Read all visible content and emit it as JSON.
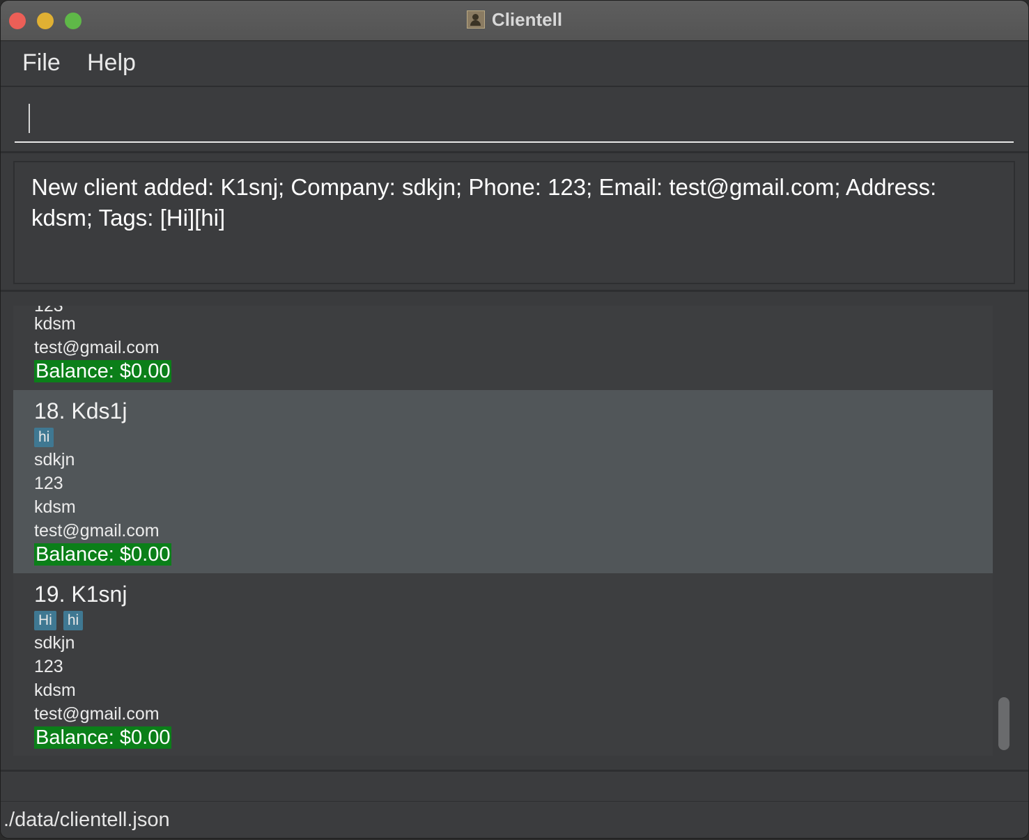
{
  "window": {
    "title": "Clientell",
    "icon": "contacts-book-icon"
  },
  "menu": {
    "items": [
      "File",
      "Help"
    ]
  },
  "command": {
    "value": ""
  },
  "result": {
    "message": "New client added: K1snj; Company: sdkjn; Phone: 123; Email: test@gmail.com; Address: kdsm; Tags: [Hi][hi]"
  },
  "clients": [
    {
      "partial_top": "123",
      "address": "kdsm",
      "email": "test@gmail.com",
      "balance": "Balance: $0.00"
    },
    {
      "name": "18. Kds1j",
      "tags": [
        "hi"
      ],
      "company": "sdkjn",
      "phone": "123",
      "address": "kdsm",
      "email": "test@gmail.com",
      "balance": "Balance: $0.00"
    },
    {
      "name": "19. K1snj",
      "tags": [
        "Hi",
        "hi"
      ],
      "company": "sdkjn",
      "phone": "123",
      "address": "kdsm",
      "email": "test@gmail.com",
      "balance": "Balance: $0.00"
    }
  ],
  "status": {
    "file_path": "./data/clientell.json"
  },
  "colors": {
    "tag_bg": "#3f7892",
    "balance_bg": "#0b7f19",
    "selected_row": "#515659"
  }
}
